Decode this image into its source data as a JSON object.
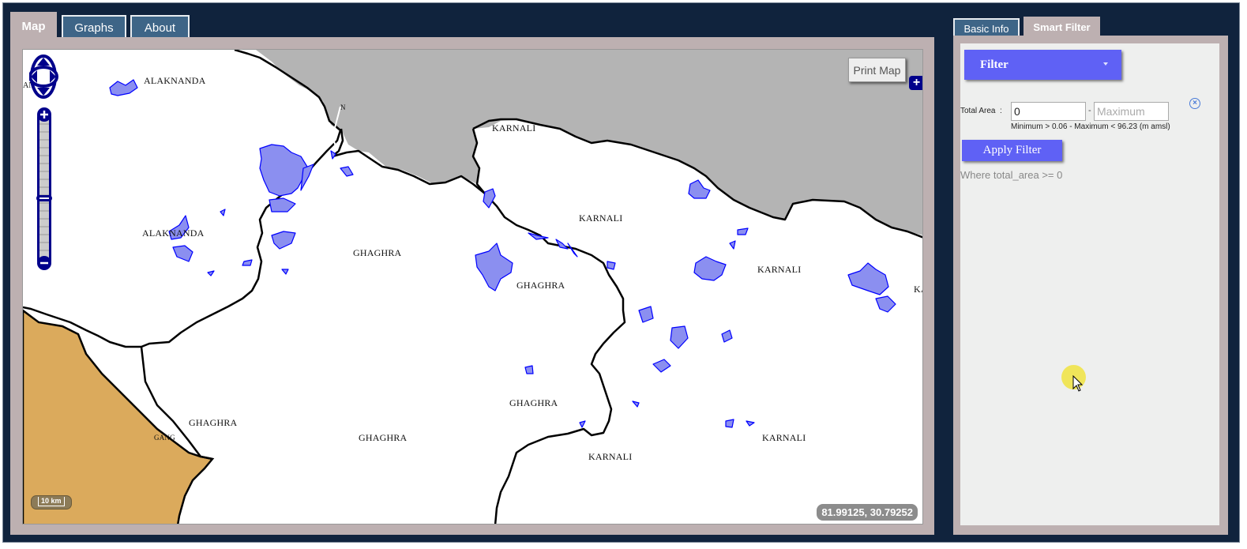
{
  "tabs": {
    "map": "Map",
    "graphs": "Graphs",
    "about": "About"
  },
  "right_tabs": {
    "basic_info": "Basic Info",
    "smart_filter": "Smart Filter"
  },
  "map": {
    "print_label": "Print Map",
    "coordinates": "81.99125, 30.79252",
    "scale_label": "10 km",
    "labels": {
      "alaknanda_1": "ALAKNANDA",
      "alaknanda_2": "ALAKNANDA",
      "and_edge": "ANI",
      "n_edge": "N",
      "karnali_1": "KARNALI",
      "karnali_2": "KARNALI",
      "karnali_3": "KARNALI",
      "karnali_4": "KARNALI",
      "karnali_5": "KARNALI",
      "ka_edge": "KA",
      "ghaghra_1": "GHAGHRA",
      "ghaghra_2": "GHAGHRA",
      "ghaghra_3": "GHAGHRA",
      "ghaghra_4": "GHAGHRA",
      "ghaghra_5": "GHAGHRA",
      "gang_edge": "GANG"
    },
    "colors": {
      "grey_region": "#b4b4b4",
      "tan_region": "#dbaa5c",
      "lake_fill": "#8b8ff0",
      "lake_stroke": "#0000ff"
    }
  },
  "filter": {
    "dropdown_label": "Filter",
    "total_area_label": "Total Area",
    "separator": ":",
    "min_value": "0",
    "max_placeholder": "Maximum",
    "range_dash": "-",
    "range_note": "Minimum > 0.06 - Maximum < 96.23 (m amsl)",
    "apply_label": "Apply Filter",
    "where_clause": "Where total_area >= 0"
  }
}
